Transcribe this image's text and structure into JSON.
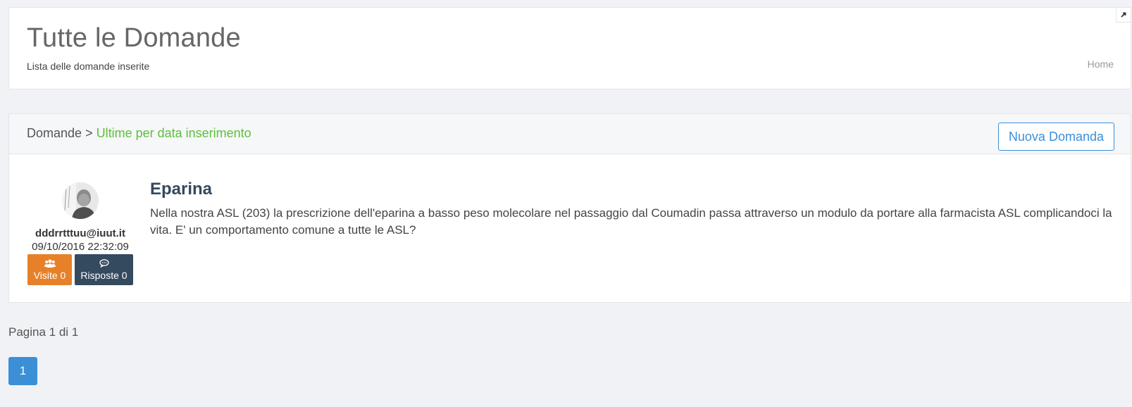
{
  "header": {
    "title": "Tutte le Domande",
    "subtitle": "Lista delle domande inserite",
    "home_link": "Home",
    "expand_icon": "expand-arrow-icon"
  },
  "panel": {
    "breadcrumb_root": "Domande",
    "breadcrumb_separator": ">",
    "breadcrumb_current": "Ultime per data inserimento",
    "new_button_label": "Nuova Domanda"
  },
  "questions": [
    {
      "author_email": "dddrrtttuu@iuut.it",
      "date": "09/10/2016 22:32:09",
      "visits_label": "Visite 0",
      "answers_label": "Risposte 0",
      "visits_icon": "users-icon",
      "answers_icon": "comment-icon",
      "title": "Eparina",
      "text": "Nella nostra ASL (203) la prescrizione dell'eparina a basso peso molecolare nel passaggio dal Coumadin passa attraverso un modulo da portare alla farmacista ASL complicandoci la vita. E' un comportamento comune a tutte le ASL?"
    }
  ],
  "pagination": {
    "label": "Pagina 1 di 1",
    "current_page": "1"
  },
  "colors": {
    "accent": "#3a8fd6",
    "green": "#5cc03a",
    "orange": "#e6812a",
    "dark": "#344a5e"
  }
}
